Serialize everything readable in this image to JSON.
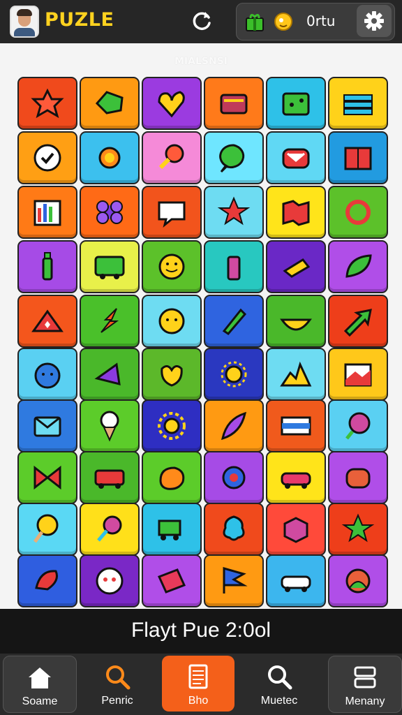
{
  "header": {
    "logo_text": "PUZLE",
    "coin_amount": "0rtu",
    "icons": [
      "avatar",
      "refresh-icon",
      "gift-icon",
      "coin-icon",
      "settings-gear-icon"
    ]
  },
  "board": {
    "subtitle": "MIALSNSI",
    "rows": [
      [
        {
          "color": "#f04a1c",
          "icon": "star-creature-icon"
        },
        {
          "color": "#ff9a12",
          "icon": "glove-icon"
        },
        {
          "color": "#9b3be0",
          "icon": "heart-swirl-icon"
        },
        {
          "color": "#ff7a1a",
          "icon": "treasure-chest-icon"
        },
        {
          "color": "#2ec1e8",
          "icon": "dice-box-icon"
        },
        {
          "color": "#ffd21a",
          "icon": "book-stack-icon"
        }
      ],
      [
        {
          "color": "#ff9f14",
          "icon": "checkmark-icon"
        },
        {
          "color": "#3cc0ee",
          "icon": "turtle-icon"
        },
        {
          "color": "#f58ad8",
          "icon": "drumstick-icon"
        },
        {
          "color": "#6fe6ff",
          "icon": "chat-bubble-icon"
        },
        {
          "color": "#60d8f4",
          "icon": "envelope-icon"
        },
        {
          "color": "#229be0",
          "icon": "red-book-icon"
        }
      ],
      [
        {
          "color": "#ff7a16",
          "icon": "bar-chart-icon"
        },
        {
          "color": "#ff6a16",
          "icon": "flower-icon"
        },
        {
          "color": "#f2541c",
          "icon": "speech-leaf-icon"
        },
        {
          "color": "#6edcf2",
          "icon": "red-star-icon"
        },
        {
          "color": "#ffe41a",
          "icon": "map-icon"
        },
        {
          "color": "#5cc12a",
          "icon": "recycle-icon"
        }
      ],
      [
        {
          "color": "#a64be6",
          "icon": "bottle-icon"
        },
        {
          "color": "#e8f04a",
          "icon": "bus-icon"
        },
        {
          "color": "#5cc12a",
          "icon": "smiley-blob-icon"
        },
        {
          "color": "#28c8c0",
          "icon": "jar-icon"
        },
        {
          "color": "#6a28c6",
          "icon": "cheese-icon"
        },
        {
          "color": "#b04ee8",
          "icon": "leaf-icon"
        }
      ],
      [
        {
          "color": "#f4561c",
          "icon": "house-icon"
        },
        {
          "color": "#4ac02a",
          "icon": "lightning-icon"
        },
        {
          "color": "#6edcf2",
          "icon": "sun-face-icon"
        },
        {
          "color": "#2f64e0",
          "icon": "crayon-icon"
        },
        {
          "color": "#4ab82a",
          "icon": "watermelon-icon"
        },
        {
          "color": "#ee3e1a",
          "icon": "arrow-icon"
        }
      ],
      [
        {
          "color": "#5ad0f2",
          "icon": "blue-blob-icon"
        },
        {
          "color": "#4ab82a",
          "icon": "megaphone-icon"
        },
        {
          "color": "#5cb82a",
          "icon": "bird-icon"
        },
        {
          "color": "#2a38c0",
          "icon": "sun-icon"
        },
        {
          "color": "#6edcf2",
          "icon": "mountain-icon"
        },
        {
          "color": "#ffc81a",
          "icon": "picture-icon"
        }
      ],
      [
        {
          "color": "#2f7ae0",
          "icon": "mail-icon"
        },
        {
          "color": "#5ccc2a",
          "icon": "icecream-icon"
        },
        {
          "color": "#2e2ec2",
          "icon": "gear-sun-icon"
        },
        {
          "color": "#ff9a12",
          "icon": "feather-icon"
        },
        {
          "color": "#f05a1c",
          "icon": "flag-icon"
        },
        {
          "color": "#5ad0f2",
          "icon": "balloon-icon"
        }
      ],
      [
        {
          "color": "#5ccc2a",
          "icon": "bow-icon"
        },
        {
          "color": "#4ab82a",
          "icon": "truck-icon"
        },
        {
          "color": "#5ccc2a",
          "icon": "potato-icon"
        },
        {
          "color": "#a64be6",
          "icon": "swirl-icon"
        },
        {
          "color": "#ffe41a",
          "icon": "car-icon"
        },
        {
          "color": "#b04ee8",
          "icon": "barrel-icon"
        }
      ],
      [
        {
          "color": "#5ad8f4",
          "icon": "lollipop-icon"
        },
        {
          "color": "#ffe01a",
          "icon": "candy-icon"
        },
        {
          "color": "#2ec1e8",
          "icon": "cart-icon"
        },
        {
          "color": "#f04a1c",
          "icon": "octopus-icon"
        },
        {
          "color": "#ff4a3a",
          "icon": "cube-icon"
        },
        {
          "color": "#ee3e1a",
          "icon": "green-star-icon"
        }
      ],
      [
        {
          "color": "#2f5ee0",
          "icon": "bird-red-icon"
        },
        {
          "color": "#7a28c6",
          "icon": "face-icon"
        },
        {
          "color": "#b04ee8",
          "icon": "eraser-icon"
        },
        {
          "color": "#ff9a12",
          "icon": "pennant-icon"
        },
        {
          "color": "#3cb6ee",
          "icon": "white-car-icon"
        },
        {
          "color": "#b04ee8",
          "icon": "snail-icon"
        }
      ]
    ]
  },
  "status": {
    "text": "Flayt Pue 2:0ol"
  },
  "nav": {
    "items": [
      {
        "label": "Soame",
        "icon": "home-icon",
        "active": false
      },
      {
        "label": "Penric",
        "icon": "search-icon",
        "active": false
      },
      {
        "label": "Bho",
        "icon": "list-icon",
        "active": true
      },
      {
        "label": "Muetec",
        "icon": "search-icon",
        "active": false
      },
      {
        "label": "Menany",
        "icon": "menu-icon",
        "active": false
      }
    ]
  }
}
